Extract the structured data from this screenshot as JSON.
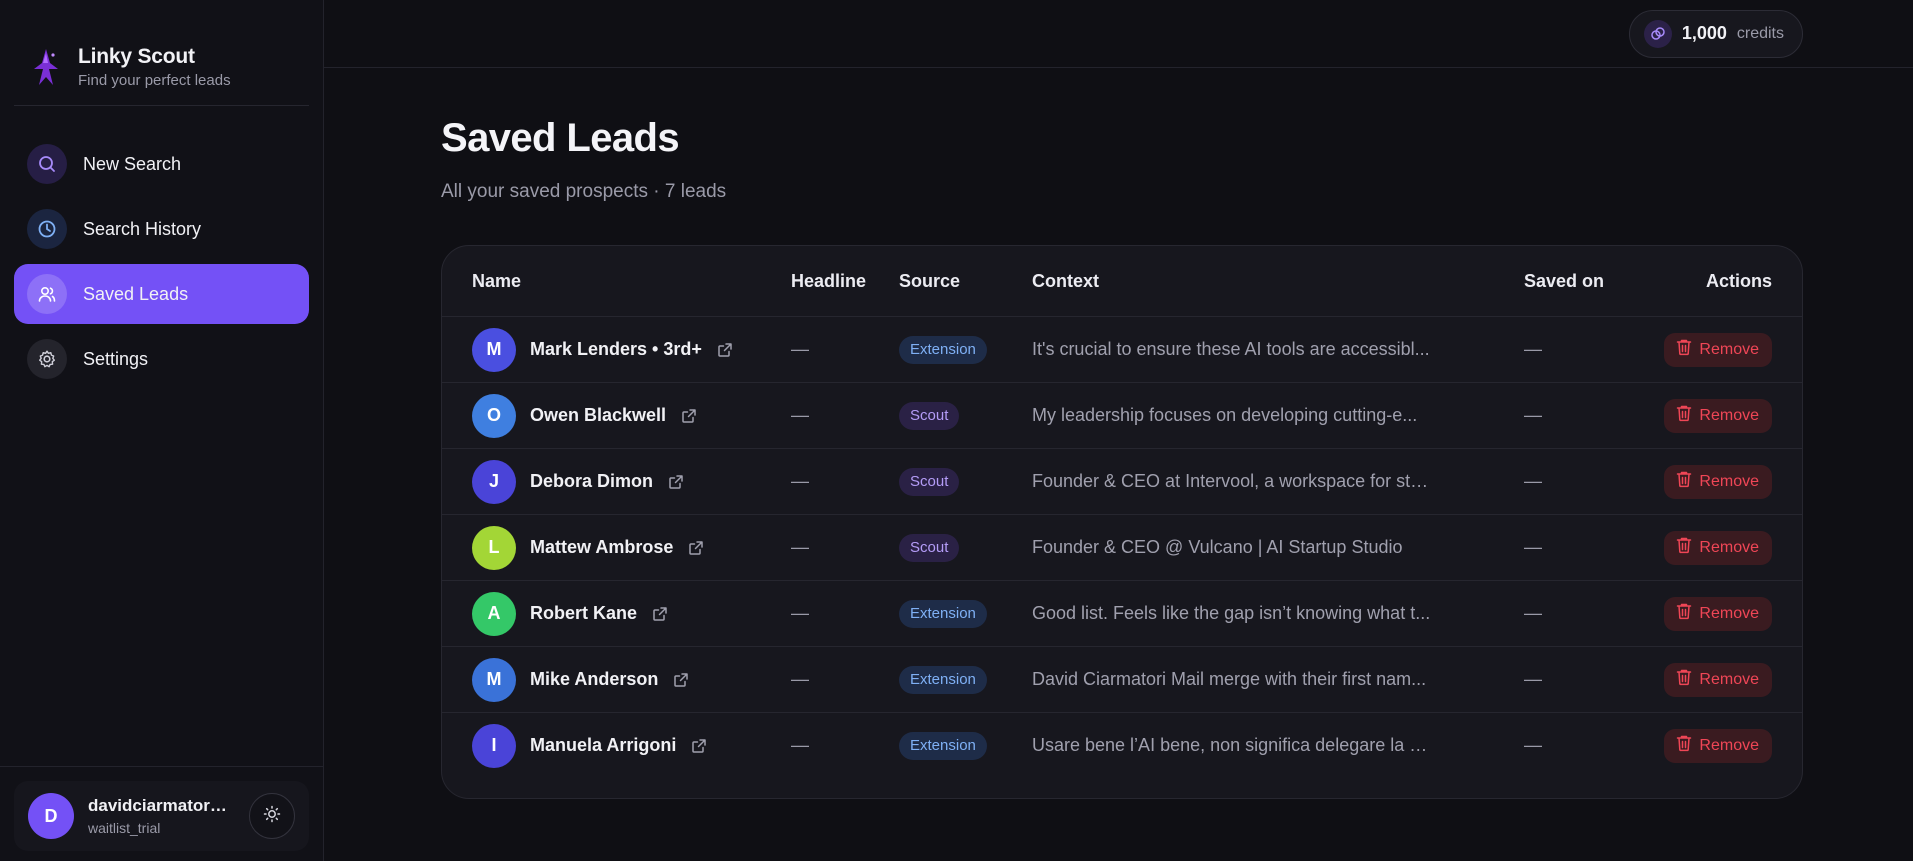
{
  "brand": {
    "title": "Linky Scout",
    "subtitle": "Find your perfect leads"
  },
  "nav": [
    {
      "label": "New Search",
      "icon": "search-icon",
      "active": false
    },
    {
      "label": "Search History",
      "icon": "clock-icon",
      "active": false
    },
    {
      "label": "Saved Leads",
      "icon": "users-icon",
      "active": true
    },
    {
      "label": "Settings",
      "icon": "gear-icon",
      "active": false
    }
  ],
  "user": {
    "initial": "D",
    "name": "davidciarmatori...",
    "plan": "waitlist_trial"
  },
  "credits": {
    "amount": "1,000",
    "label": "credits"
  },
  "page": {
    "title": "Saved Leads",
    "subtitle": "All your saved prospects · 7 leads"
  },
  "table": {
    "headers": {
      "name": "Name",
      "headline": "Headline",
      "source": "Source",
      "context": "Context",
      "saved": "Saved on",
      "actions": "Actions"
    },
    "rows": [
      {
        "initial": "M",
        "name": "Mark Lenders • 3rd+",
        "headline": "—",
        "source": "Extension",
        "source_type": "extension",
        "context": "It's crucial to ensure these AI tools are accessibl...",
        "saved": "—",
        "action": "Remove",
        "avatar_color": "#4a4fe0"
      },
      {
        "initial": "O",
        "name": "Owen Blackwell",
        "headline": "—",
        "source": "Scout",
        "source_type": "scout",
        "context": "My leadership focuses on developing cutting-e...",
        "saved": "—",
        "action": "Remove",
        "avatar_color": "#3f7fe0"
      },
      {
        "initial": "J",
        "name": "Debora Dimon",
        "headline": "—",
        "source": "Scout",
        "source_type": "scout",
        "context": "Founder & CEO at Intervool, a workspace for sta...",
        "saved": "—",
        "action": "Remove",
        "avatar_color": "#4a44d8"
      },
      {
        "initial": "L",
        "name": "Mattew Ambrose",
        "headline": "—",
        "source": "Scout",
        "source_type": "scout",
        "context": "Founder & CEO @ Vulcano | AI Startup Studio",
        "saved": "—",
        "action": "Remove",
        "avatar_color": "#a3d636"
      },
      {
        "initial": "A",
        "name": "Robert Kane",
        "headline": "—",
        "source": "Extension",
        "source_type": "extension",
        "context": "Good list. Feels like the gap isn’t knowing what t...",
        "saved": "—",
        "action": "Remove",
        "avatar_color": "#34c868"
      },
      {
        "initial": "M",
        "name": "Mike Anderson",
        "headline": "—",
        "source": "Extension",
        "source_type": "extension",
        "context": "David Ciarmatori Mail merge with their first nam...",
        "saved": "—",
        "action": "Remove",
        "avatar_color": "#3a72d8"
      },
      {
        "initial": "I",
        "name": "Manuela Arrigoni",
        "headline": "—",
        "source": "Extension",
        "source_type": "extension",
        "context": "Usare bene l’AI bene, non significa delegare la d...",
        "saved": "—",
        "action": "Remove",
        "avatar_color": "#4a44d8"
      }
    ]
  },
  "colors": {
    "accent": "#7451f6",
    "danger": "#ef4656",
    "background": "#0f0f14"
  }
}
